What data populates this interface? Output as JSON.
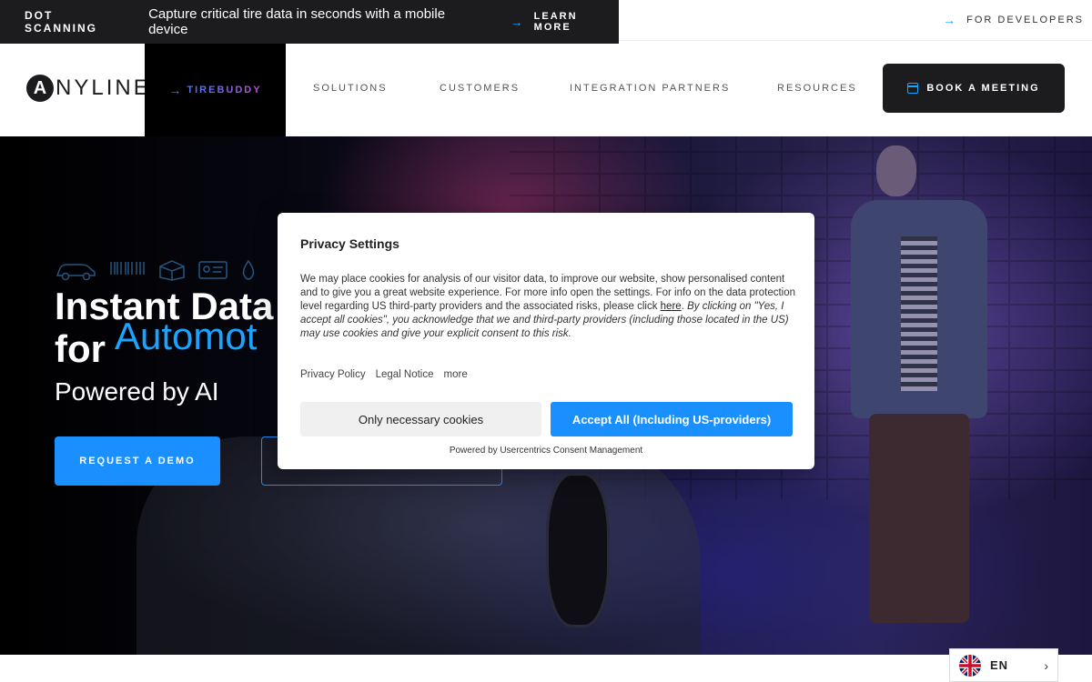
{
  "promo": {
    "tag": "DOT SCANNING",
    "text": "Capture critical tire data in seconds with a mobile device",
    "link": "LEARN MORE"
  },
  "dev_link": "FOR DEVELOPERS",
  "nav": {
    "logo_letter": "A",
    "logo_word": "NYLINE",
    "tirebuddy": "TIREBUDDY",
    "items": [
      "SOLUTIONS",
      "CUSTOMERS",
      "INTEGRATION PARTNERS",
      "RESOURCES"
    ],
    "book": "BOOK A MEETING"
  },
  "hero": {
    "title_line1": "Instant Data",
    "title_for": "for",
    "title_highlight": "Automot",
    "subtitle": "Powered by AI",
    "demo_button": "REQUEST A DEMO"
  },
  "cookie_modal": {
    "title": "Privacy Settings",
    "body_part1": "We may place cookies for analysis of our visitor data, to improve our website, show personalised content and to give you a great website experience. For more info open the settings. For info on the data protection level regarding US third-party providers and the associated risks, please click ",
    "body_link": "here",
    "body_part2": ". ",
    "body_italic": "By clicking on \"Yes, I accept all cookies\", you acknowledge that we and third-party providers (including those located in the US) may use cookies and give your explicit consent to this risk.",
    "links": [
      "Privacy Policy",
      "Legal Notice",
      "more"
    ],
    "btn_necessary": "Only necessary cookies",
    "btn_accept": "Accept All (Including US-providers)",
    "powered": "Powered by Usercentrics Consent Management"
  },
  "language": {
    "label": "EN",
    "flag": "uk-flag-icon"
  },
  "colors": {
    "accent": "#1a8fff",
    "dark": "#1c1c1e"
  }
}
